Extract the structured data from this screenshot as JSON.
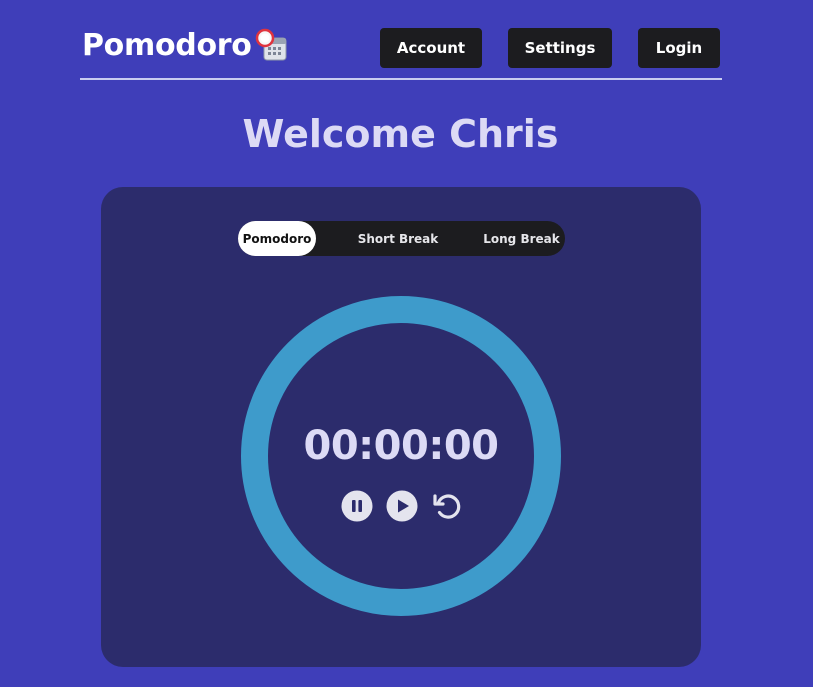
{
  "header": {
    "brand": "Pomodoro",
    "brand_icon": "calendar-clock-icon",
    "nav": [
      {
        "label": "Account"
      },
      {
        "label": "Settings"
      },
      {
        "label": "Login"
      }
    ]
  },
  "welcome": "Welcome Chris",
  "modes": {
    "active": "Pomodoro",
    "items": [
      {
        "label": "Pomodoro"
      },
      {
        "label": "Short Break"
      },
      {
        "label": "Long Break"
      }
    ]
  },
  "timer": {
    "display": "00:00:00",
    "ring_color": "#3e9bcb"
  },
  "controls": [
    {
      "icon": "pause-icon"
    },
    {
      "icon": "play-icon"
    },
    {
      "icon": "reset-icon"
    }
  ],
  "colors": {
    "background": "#3f3eb9",
    "card": "#2c2c6c",
    "button": "#1c1c1f",
    "title": "#dcdaf5"
  }
}
